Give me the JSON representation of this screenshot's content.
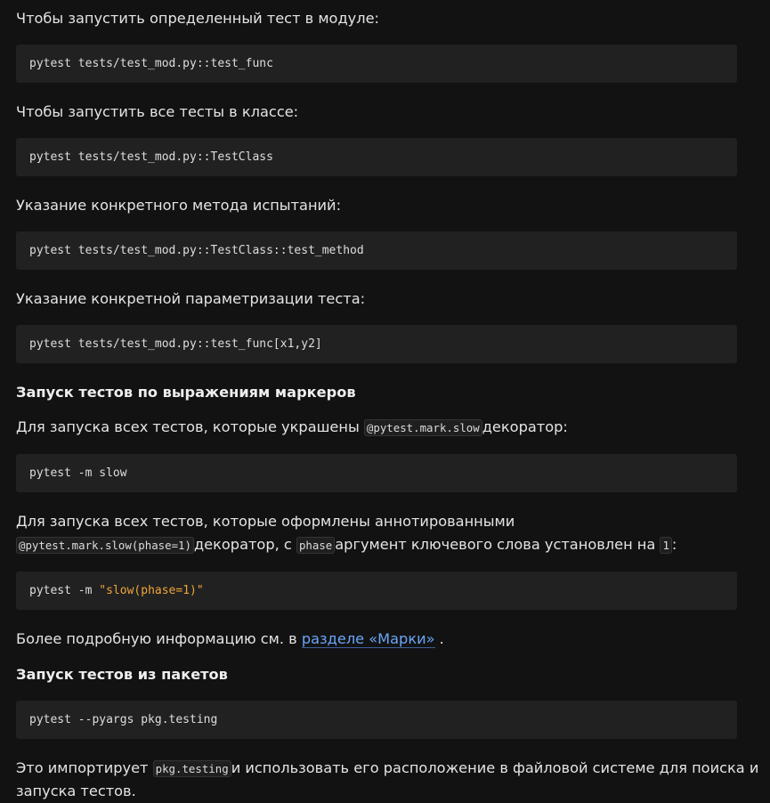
{
  "sections": {
    "p1": "Чтобы запустить определенный тест в модуле:",
    "c1": "pytest tests/test_mod.py::test_func",
    "p2": "Чтобы запустить все тесты в классе:",
    "c2": "pytest tests/test_mod.py::TestClass",
    "p3": "Указание конкретного метода испытаний:",
    "c3": "pytest tests/test_mod.py::TestClass::test_method",
    "p4": "Указание конкретной параметризации теста:",
    "c4": "pytest tests/test_mod.py::test_func[x1,y2]",
    "h1": "Запуск тестов по выражениям маркеров",
    "p5_a": "Для запуска всех тестов, которые украшены ",
    "p5_code": "@pytest.mark.slow",
    "p5_b": "декоратор:",
    "c5": "pytest -m slow",
    "p6_line1": "Для запуска всех тестов, которые оформлены аннотированными",
    "p6_code1": "@pytest.mark.slow(phase=1)",
    "p6_b": "декоратор, с ",
    "p6_code2": "phase",
    "p6_c": "аргумент ключевого слова установлен на ",
    "p6_code3": "1",
    "p6_d": ":",
    "c6_cmd": "pytest -m ",
    "c6_str": "\"slow(phase=1)\"",
    "p7_a": "Более подробную информацию см. в ",
    "p7_link": "разделе «Марки»",
    "p7_b": " .",
    "h2": "Запуск тестов из пакетов",
    "c7": "pytest --pyargs pkg.testing",
    "p8_a": "Это импортирует ",
    "p8_code": "pkg.testing",
    "p8_b": "и использовать его расположение в файловой системе для поиска и",
    "p8_line2": "запуска тестов."
  }
}
